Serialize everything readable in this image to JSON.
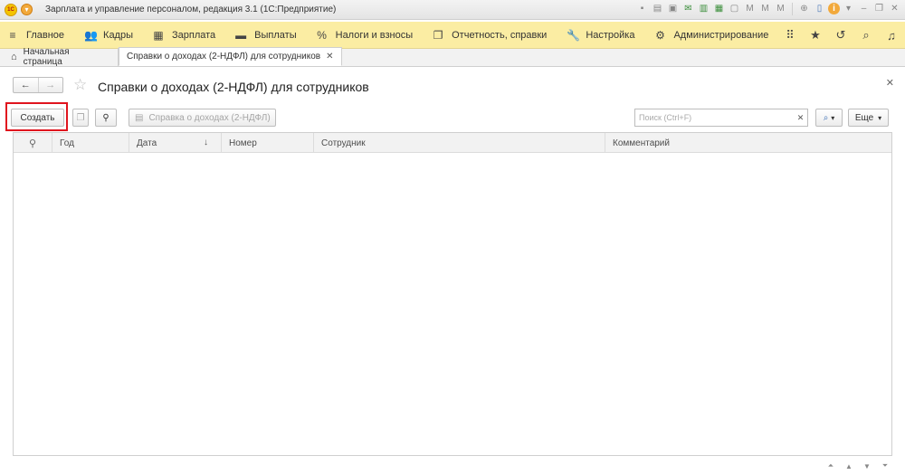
{
  "window": {
    "title": "Зарплата и управление персоналом, редакция 3.1  (1С:Предприятие)",
    "logo_text": "1С"
  },
  "sections": [
    {
      "icon": "hamburger-icon",
      "glyph": "≡",
      "label": "Главное"
    },
    {
      "icon": "staff-icon",
      "glyph": "👥",
      "label": "Кадры"
    },
    {
      "icon": "calculator-icon",
      "glyph": "▦",
      "label": "Зарплата"
    },
    {
      "icon": "wallet-icon",
      "glyph": "▬",
      "label": "Выплаты"
    },
    {
      "icon": "percent-icon",
      "glyph": "%",
      "label": "Налоги и взносы"
    },
    {
      "icon": "report-icon",
      "glyph": "❐",
      "label": "Отчетность, справки"
    },
    {
      "icon": "wrench-icon",
      "glyph": "🔧",
      "label": "Настройка"
    },
    {
      "icon": "gear-icon",
      "glyph": "⚙",
      "label": "Администрирование"
    }
  ],
  "tabs": {
    "home": "Начальная страница",
    "active": "Справки о доходах (2-НДФЛ) для сотрудников"
  },
  "form": {
    "title": "Справки о доходах (2-НДФЛ) для сотрудников"
  },
  "toolbar": {
    "create": "Создать",
    "print": "Справка о доходах (2-НДФЛ)",
    "search_placeholder": "Поиск (Ctrl+F)",
    "more": "Еще"
  },
  "table": {
    "columns": [
      "Год",
      "Дата",
      "Номер",
      "Сотрудник",
      "Комментарий"
    ],
    "rows": []
  },
  "colors": {
    "sections_bg": "#fbeda3",
    "highlight": "#e0141e"
  }
}
